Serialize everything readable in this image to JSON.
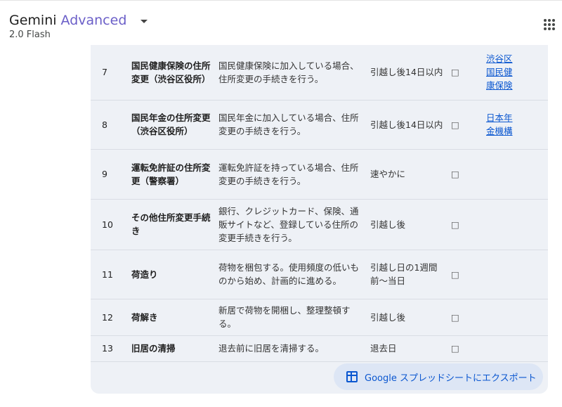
{
  "header": {
    "app_name": "Gemini",
    "tier": "Advanced",
    "model": "2.0 Flash"
  },
  "table": {
    "rows": [
      {
        "no": "7",
        "task": "国民健康保険の住所変更（渋谷区役所）",
        "desc": "国民健康保険に加入している場合、住所変更の手続きを行う。",
        "time": "引越し後14日以内",
        "check": "□",
        "link": "渋谷区国民健康保険"
      },
      {
        "no": "8",
        "task": "国民年金の住所変更（渋谷区役所）",
        "desc": "国民年金に加入している場合、住所変更の手続きを行う。",
        "time": "引越し後14日以内",
        "check": "□",
        "link": "日本年金機構"
      },
      {
        "no": "9",
        "task": "運転免許証の住所変更（警察署）",
        "desc": "運転免許証を持っている場合、住所変更の手続きを行う。",
        "time": "速やかに",
        "check": "□",
        "link": ""
      },
      {
        "no": "10",
        "task": "その他住所変更手続き",
        "desc": "銀行、クレジットカード、保険、通販サイトなど、登録している住所の変更手続きを行う。",
        "time": "引越し後",
        "check": "□",
        "link": ""
      },
      {
        "no": "11",
        "task": "荷造り",
        "desc": "荷物を梱包する。使用頻度の低いものから始め、計画的に進める。",
        "time": "引越し日の1週間前〜当日",
        "check": "□",
        "link": ""
      },
      {
        "no": "12",
        "task": "荷解き",
        "desc": "新居で荷物を開梱し、整理整頓する。",
        "time": "引越し後",
        "check": "□",
        "link": ""
      },
      {
        "no": "13",
        "task": "旧居の清掃",
        "desc": "退去前に旧居を清掃する。",
        "time": "退去日",
        "check": "□",
        "link": ""
      }
    ]
  },
  "export": {
    "label": "Google スプレッドシートにエクスポート"
  },
  "icons": {
    "apps": "apps-grid-icon",
    "sheet": "table-sheet-icon",
    "dropdown": "caret-down-icon"
  },
  "colors": {
    "tier": "#6b5fc8",
    "link": "#0b57d0",
    "panel_bg": "#eef1f6",
    "button_bg": "#dde6f5"
  }
}
